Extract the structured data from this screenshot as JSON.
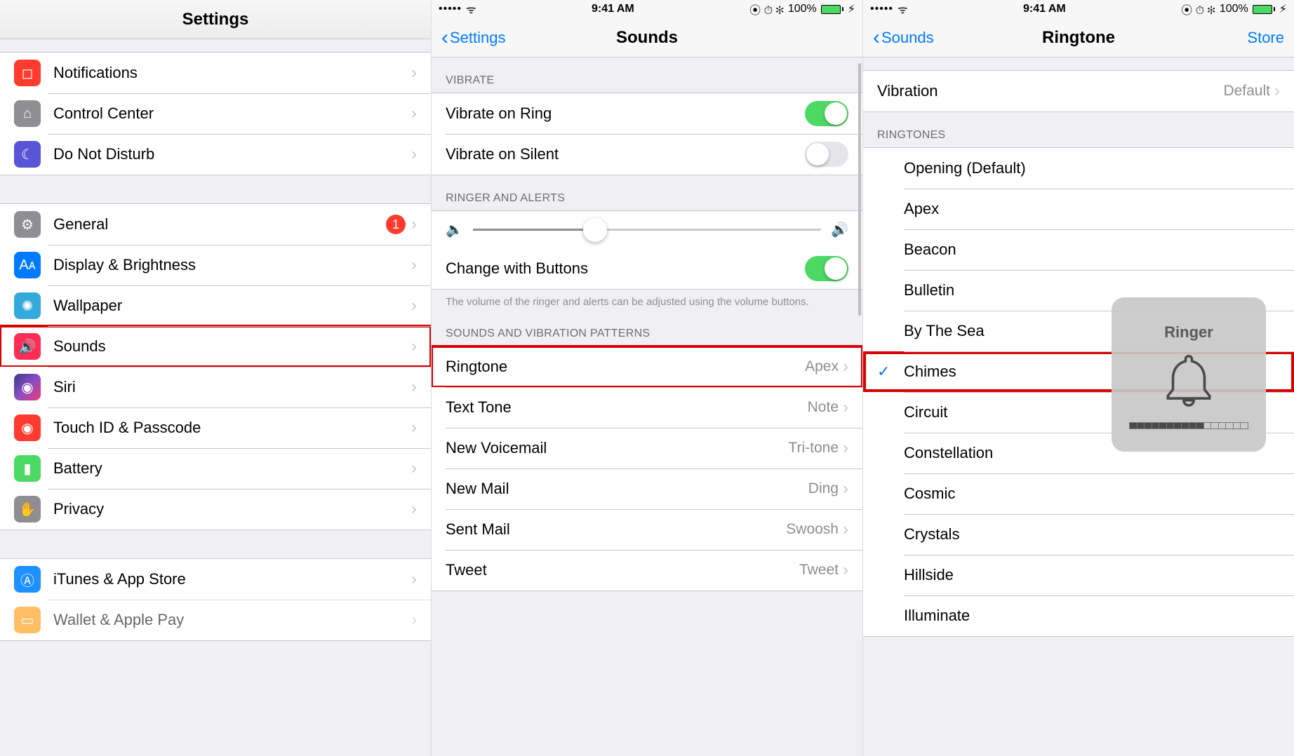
{
  "status": {
    "time": "9:41 AM",
    "battery_pct": "100%",
    "signal": "•••••",
    "indicators": "⦿ ⏱ ✻"
  },
  "panel1": {
    "title": "Settings",
    "groups": [
      [
        {
          "id": "notifications",
          "label": "Notifications"
        },
        {
          "id": "control-center",
          "label": "Control Center"
        },
        {
          "id": "dnd",
          "label": "Do Not Disturb"
        }
      ],
      [
        {
          "id": "general",
          "label": "General",
          "badge": "1"
        },
        {
          "id": "display",
          "label": "Display & Brightness"
        },
        {
          "id": "wallpaper",
          "label": "Wallpaper"
        },
        {
          "id": "sounds",
          "label": "Sounds",
          "highlight": true
        },
        {
          "id": "siri",
          "label": "Siri"
        },
        {
          "id": "touchid",
          "label": "Touch ID & Passcode"
        },
        {
          "id": "battery",
          "label": "Battery"
        },
        {
          "id": "privacy",
          "label": "Privacy"
        }
      ],
      [
        {
          "id": "itunes",
          "label": "iTunes & App Store"
        },
        {
          "id": "wallet",
          "label": "Wallet & Apple Pay"
        }
      ]
    ]
  },
  "panel2": {
    "back": "Settings",
    "title": "Sounds",
    "sections": {
      "vibrate_header": "Vibrate",
      "vibrate_on_ring": "Vibrate on Ring",
      "vibrate_on_silent": "Vibrate on Silent",
      "ringer_header": "Ringer and Alerts",
      "change_with_buttons": "Change with Buttons",
      "footer": "The volume of the ringer and alerts can be adjusted using the volume buttons.",
      "patterns_header": "Sounds and Vibration Patterns",
      "rows": [
        {
          "label": "Ringtone",
          "value": "Apex",
          "highlight": true
        },
        {
          "label": "Text Tone",
          "value": "Note"
        },
        {
          "label": "New Voicemail",
          "value": "Tri-tone"
        },
        {
          "label": "New Mail",
          "value": "Ding"
        },
        {
          "label": "Sent Mail",
          "value": "Swoosh"
        },
        {
          "label": "Tweet",
          "value": "Tweet"
        }
      ]
    }
  },
  "panel3": {
    "back": "Sounds",
    "title": "Ringtone",
    "right": "Store",
    "vibration_label": "Vibration",
    "vibration_value": "Default",
    "ringtones_header": "Ringtones",
    "ringtones": [
      "Opening (Default)",
      "Apex",
      "Beacon",
      "Bulletin",
      "By The Sea",
      "Chimes",
      "Circuit",
      "Constellation",
      "Cosmic",
      "Crystals",
      "Hillside",
      "Illuminate"
    ],
    "selected": "Chimes",
    "hud_title": "Ringer"
  }
}
